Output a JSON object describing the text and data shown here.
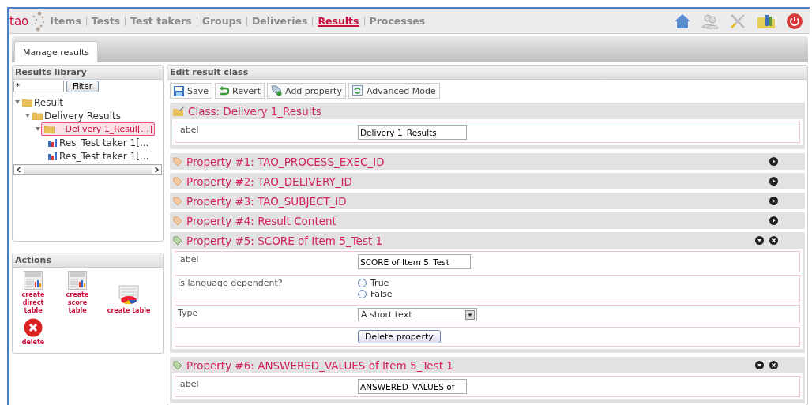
{
  "header": {
    "logo": "tao",
    "nav": [
      {
        "label": "Items",
        "selected": false
      },
      {
        "label": "Tests",
        "selected": false
      },
      {
        "label": "Test takers",
        "selected": false
      },
      {
        "label": "Groups",
        "selected": false
      },
      {
        "label": "Deliveries",
        "selected": false
      },
      {
        "label": "Results",
        "selected": true
      },
      {
        "label": "Processes",
        "selected": false
      }
    ]
  },
  "tabs": [
    {
      "label": "Manage results",
      "selected": true
    }
  ],
  "library": {
    "title": "Results library",
    "filter": {
      "value": "*",
      "button": "Filter"
    },
    "tree": [
      {
        "label": "Result",
        "kind": "folder",
        "expanded": true,
        "selected": false,
        "children": [
          {
            "label": "Delivery Results",
            "kind": "folder",
            "expanded": true,
            "selected": false,
            "children": [
              {
                "label": "Delivery 1_Resul[...]",
                "kind": "folder",
                "expanded": true,
                "selected": true,
                "children": [
                  {
                    "label": "Res_Test taker 1[...",
                    "kind": "result",
                    "selected": false
                  },
                  {
                    "label": "Res_Test taker 1[...",
                    "kind": "result",
                    "selected": false
                  }
                ]
              }
            ]
          }
        ]
      }
    ]
  },
  "actions": {
    "title": "Actions",
    "items": [
      {
        "label": "create direct table",
        "kind": "direct"
      },
      {
        "label": "create score table",
        "kind": "score"
      },
      {
        "label": "create table",
        "kind": "table"
      },
      {
        "label": "delete",
        "kind": "delete"
      }
    ]
  },
  "editor": {
    "title": "Edit result class",
    "toolbar": [
      {
        "label": "Save",
        "kind": "save"
      },
      {
        "label": "Revert",
        "kind": "revert"
      },
      {
        "label": "Add property",
        "kind": "add"
      },
      {
        "label": "Advanced Mode",
        "kind": "advanced"
      }
    ],
    "class_section": {
      "title": "Class: Delivery 1_Results",
      "fields": [
        {
          "kind": "text",
          "label": "label",
          "value": "Delivery 1_Results"
        }
      ]
    },
    "properties": [
      {
        "title": "Property #1: TAO_PROCESS_EXEC_ID",
        "expanded": false
      },
      {
        "title": "Property #2: TAO_DELIVERY_ID",
        "expanded": false
      },
      {
        "title": "Property #3: TAO_SUBJECT_ID",
        "expanded": false
      },
      {
        "title": "Property #4: Result Content",
        "expanded": false
      },
      {
        "title": "Property #5: SCORE of Item 5_Test 1",
        "expanded": true,
        "fields": [
          {
            "kind": "text",
            "label": "label",
            "value": "SCORE of Item 5_Test"
          },
          {
            "kind": "radio",
            "label": "Is language dependent?",
            "options": [
              {
                "label": "True",
                "selected": false
              },
              {
                "label": "False",
                "selected": false
              }
            ]
          },
          {
            "kind": "select",
            "label": "Type",
            "value": "A short text"
          },
          {
            "kind": "button",
            "value": "Delete property"
          }
        ]
      },
      {
        "title": "Property #6: ANSWERED_VALUES of Item 5_Test 1",
        "expanded": true,
        "fields": [
          {
            "kind": "text",
            "label": "label",
            "value": "ANSWERED_VALUES of"
          }
        ]
      }
    ]
  }
}
